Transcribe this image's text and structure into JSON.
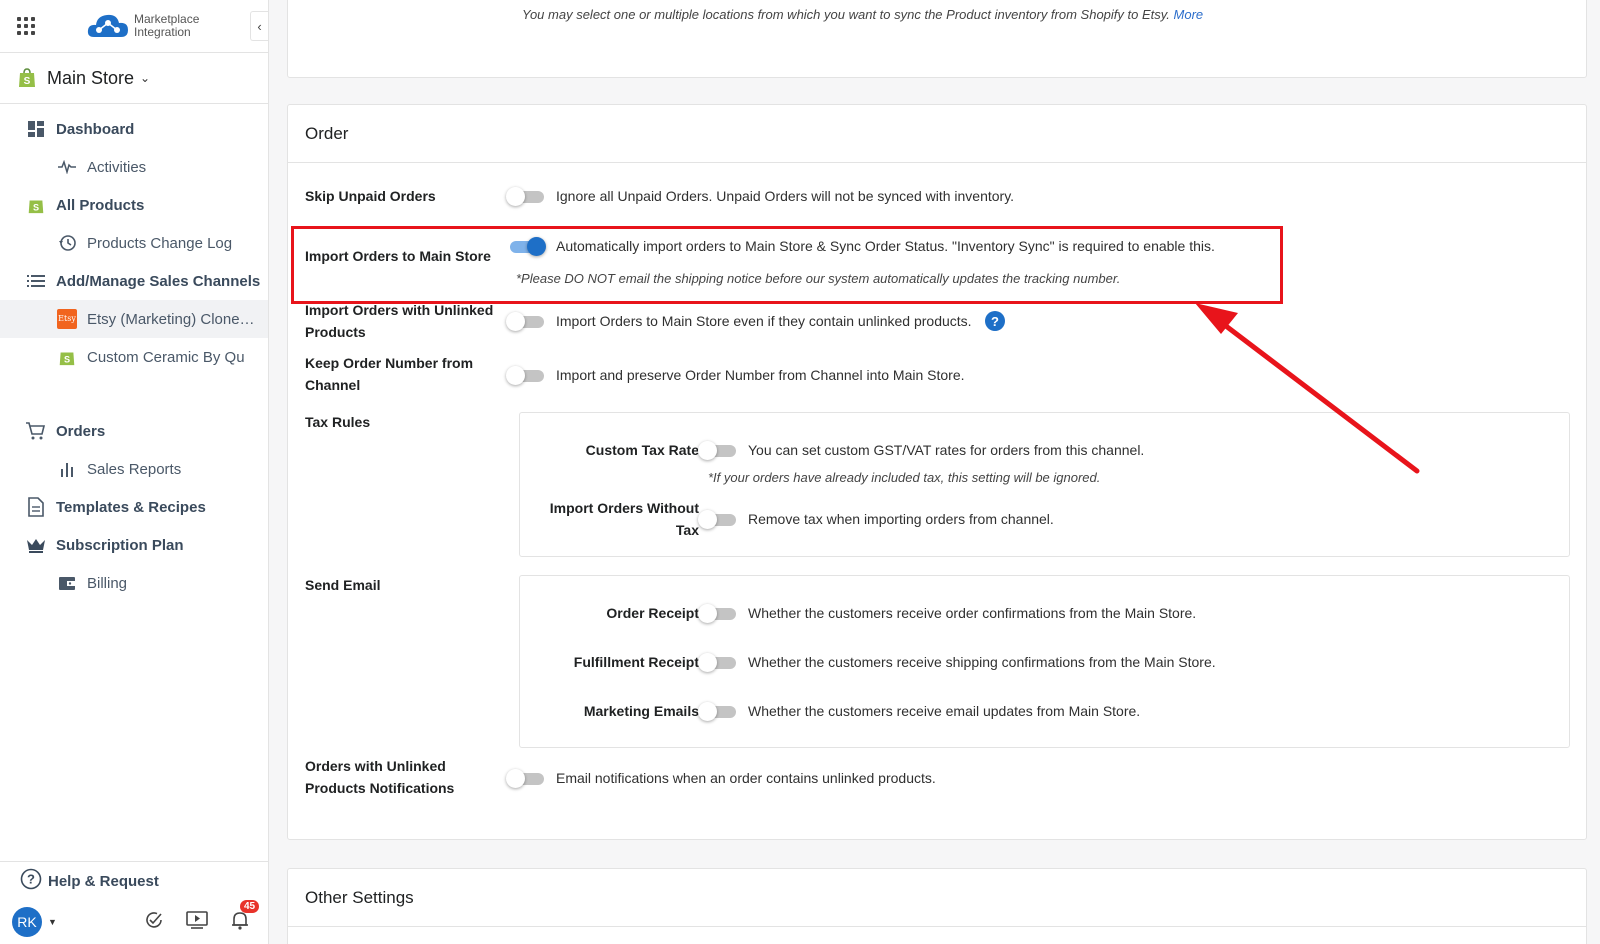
{
  "app": {
    "logo_line1": "Marketplace",
    "logo_line2": "Integration",
    "store": "Main Store"
  },
  "sidebar": {
    "items": [
      {
        "label": "Dashboard",
        "level": 1,
        "icon": "dashboard-icon"
      },
      {
        "label": "Activities",
        "level": 2,
        "icon": "activity-icon"
      },
      {
        "label": "All Products",
        "level": 1,
        "icon": "shopify-bag-icon"
      },
      {
        "label": "Products Change Log",
        "level": 2,
        "icon": "history-icon"
      },
      {
        "label": "Add/Manage Sales Channels",
        "level": 1,
        "icon": "list-icon"
      },
      {
        "label": "Etsy (Marketing) Clone…",
        "level": 2,
        "icon": "etsy-icon",
        "active": true
      },
      {
        "label": "Custom Ceramic By Qu",
        "level": 2,
        "icon": "shopify-bag-icon"
      },
      {
        "label": "Orders",
        "level": 1,
        "icon": "cart-icon"
      },
      {
        "label": "Sales Reports",
        "level": 2,
        "icon": "bar-chart-icon"
      },
      {
        "label": "Templates & Recipes",
        "level": 1,
        "icon": "document-icon"
      },
      {
        "label": "Subscription Plan",
        "level": 1,
        "icon": "crown-icon"
      },
      {
        "label": "Billing",
        "level": 2,
        "icon": "wallet-icon"
      }
    ],
    "help": "Help & Request",
    "user_initials": "RK",
    "notif_count": "45",
    "etsy_badge": "Etsy"
  },
  "top_note": {
    "text": "You may select one or multiple locations from which you want to sync the Product inventory from Shopify to Etsy.",
    "more": "More"
  },
  "order": {
    "title": "Order",
    "rows": [
      {
        "label": "Skip Unpaid Orders",
        "enabled": false,
        "desc": "Ignore all Unpaid Orders. Unpaid Orders will not be synced with inventory."
      },
      {
        "label": "Import Orders to Main Store",
        "enabled": true,
        "desc": "Automatically import orders to Main Store & Sync Order Status. \"Inventory Sync\" is required to enable this.",
        "hint": "*Please DO NOT email the shipping notice before our system automatically updates the tracking number."
      },
      {
        "label": "Import Orders with Unlinked Products",
        "enabled": false,
        "desc": "Import Orders to Main Store even if they contain unlinked products.",
        "help": "?"
      },
      {
        "label": "Keep Order Number from Channel",
        "enabled": false,
        "desc": "Import and preserve Order Number from Channel into Main Store."
      }
    ],
    "tax_rules": {
      "label": "Tax Rules",
      "items": [
        {
          "label": "Custom Tax Rate",
          "enabled": false,
          "desc": "You can set custom GST/VAT rates for orders from this channel.",
          "hint": "*If your orders have already included tax, this setting will be ignored."
        },
        {
          "label": "Import Orders Without Tax",
          "enabled": false,
          "desc": "Remove tax when importing orders from channel."
        }
      ]
    },
    "send_email": {
      "label": "Send Email",
      "items": [
        {
          "label": "Order Receipt",
          "enabled": false,
          "desc": "Whether the customers receive order confirmations from the Main Store."
        },
        {
          "label": "Fulfillment Receipt",
          "enabled": false,
          "desc": "Whether the customers receive shipping confirmations from the Main Store."
        },
        {
          "label": "Marketing Emails",
          "enabled": false,
          "desc": "Whether the customers receive email updates from Main Store."
        }
      ]
    },
    "unlinked_notif": {
      "label": "Orders with Unlinked Products Notifications",
      "enabled": false,
      "desc": "Email notifications when an order contains unlinked products."
    }
  },
  "other": {
    "title": "Other Settings"
  },
  "colors": {
    "accent": "#1e6fc7",
    "highlight": "#e8141b"
  }
}
